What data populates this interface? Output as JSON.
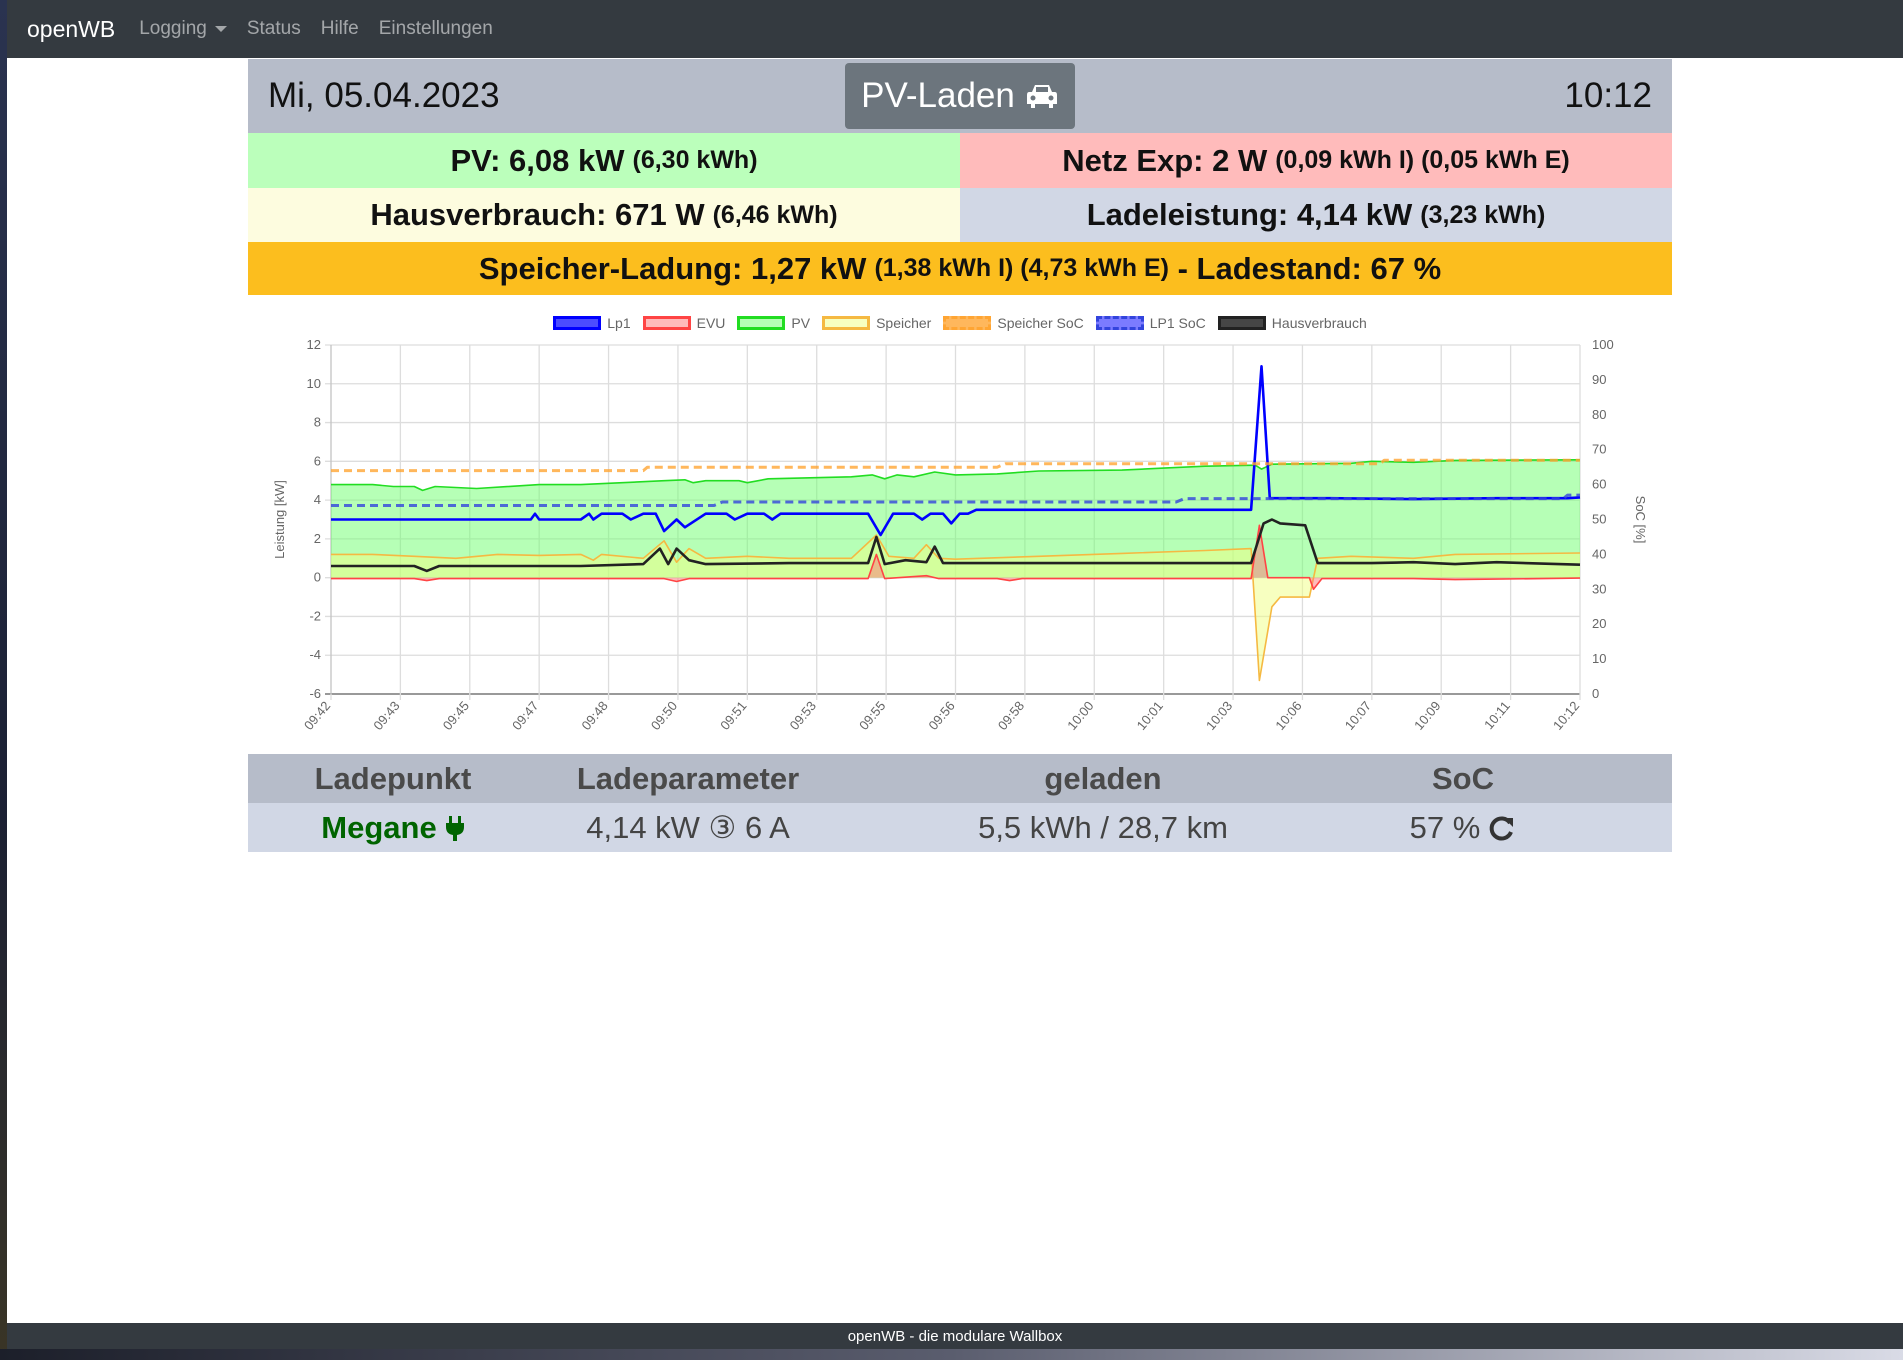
{
  "navbar": {
    "brand": "openWB",
    "items": [
      {
        "label": "Logging",
        "dropdown": true
      },
      {
        "label": "Status"
      },
      {
        "label": "Hilfe"
      },
      {
        "label": "Einstellungen"
      }
    ]
  },
  "header": {
    "date": "Mi, 05.04.2023",
    "mode": "PV-Laden",
    "mode_icon": "car-icon",
    "time": "10:12"
  },
  "summary": {
    "pv": {
      "label": "PV: 6,08 kW",
      "detail": "(6,30 kWh)",
      "color": "#bbffbb"
    },
    "netz": {
      "label": "Netz Exp: 2 W",
      "detail": "(0,09 kWh I) (0,05 kWh E)",
      "color": "#ffbbbb"
    },
    "haus": {
      "label": "Hausverbrauch: 671 W",
      "detail": "(6,46 kWh)",
      "color": "#fdfcdf"
    },
    "lade": {
      "label": "Ladeleistung: 4,14 kW",
      "detail": "(3,23 kWh)",
      "color": "#d1d7e5"
    },
    "speicher": {
      "label": "Speicher-Ladung: 1,27 kW",
      "detail": "(1,38 kWh I) (4,73 kWh E)",
      "sep": " - ",
      "ladestand": "Ladestand: 67 %",
      "color": "#fcbe1e"
    }
  },
  "chart_data": {
    "type": "line",
    "xlabel": "",
    "ylabel": "Leistung [kW]",
    "y2label": "SoC [%]",
    "ylim": [
      -6,
      12
    ],
    "y2lim": [
      0,
      100
    ],
    "xlim": [
      0,
      30
    ],
    "yticks": [
      "12",
      "10",
      "8",
      "6",
      "4",
      "2",
      "0",
      "-2",
      "-4",
      "-6"
    ],
    "y2ticks": [
      "100",
      "90",
      "80",
      "70",
      "60",
      "50",
      "40",
      "30",
      "20",
      "10",
      "0"
    ],
    "xticks": [
      "09:42",
      "09:43",
      "09:45",
      "09:47",
      "09:48",
      "09:50",
      "09:51",
      "09:53",
      "09:55",
      "09:56",
      "09:58",
      "10:00",
      "10:01",
      "10:03",
      "10:06",
      "10:07",
      "10:09",
      "10:11",
      "10:12"
    ],
    "x_unit": "minutes since 09:42",
    "legend": [
      {
        "name": "Lp1",
        "color": "#0000ff",
        "fill": "rgba(0,0,255,0.7)"
      },
      {
        "name": "EVU",
        "color": "#ff4444",
        "fill": "rgba(255,120,120,0.5)"
      },
      {
        "name": "PV",
        "color": "#22dd22",
        "fill": "rgba(110,255,110,0.5)"
      },
      {
        "name": "Speicher",
        "color": "#f5b942",
        "fill": "rgba(240,255,130,0.5)"
      },
      {
        "name": "Speicher SoC",
        "color": "#ffa533",
        "fill": "rgba(255,165,51,0.8)",
        "dashed": true
      },
      {
        "name": "LP1 SoC",
        "color": "#3344dd",
        "fill": "rgba(90,90,255,0.8)",
        "dashed": true
      },
      {
        "name": "Hausverbrauch",
        "color": "#222222",
        "fill": "rgba(50,50,50,0.9)"
      }
    ],
    "series": [
      {
        "name": "PV",
        "axis": "y",
        "fill": true,
        "points": [
          [
            0,
            4.8
          ],
          [
            1,
            4.8
          ],
          [
            1.5,
            4.7
          ],
          [
            2,
            4.7
          ],
          [
            2.2,
            4.5
          ],
          [
            2.5,
            4.7
          ],
          [
            3.5,
            4.6
          ],
          [
            5,
            4.8
          ],
          [
            6,
            4.8
          ],
          [
            8,
            5.0
          ],
          [
            8.5,
            5.05
          ],
          [
            8.7,
            4.9
          ],
          [
            9,
            5.0
          ],
          [
            9.8,
            5.0
          ],
          [
            10,
            4.9
          ],
          [
            10.5,
            5.1
          ],
          [
            12.5,
            5.2
          ],
          [
            13,
            5.3
          ],
          [
            13.3,
            5.1
          ],
          [
            13.6,
            5.3
          ],
          [
            14,
            5.2
          ],
          [
            14.5,
            5.45
          ],
          [
            15,
            5.3
          ],
          [
            16,
            5.35
          ],
          [
            17,
            5.5
          ],
          [
            19,
            5.55
          ],
          [
            20,
            5.65
          ],
          [
            21,
            5.75
          ],
          [
            22.2,
            5.8
          ],
          [
            22.35,
            5.6
          ],
          [
            22.6,
            5.85
          ],
          [
            24.5,
            5.9
          ],
          [
            25,
            6.0
          ],
          [
            26,
            5.95
          ],
          [
            27,
            6.05
          ],
          [
            30,
            6.08
          ]
        ]
      },
      {
        "name": "Speicher",
        "axis": "y",
        "fill": true,
        "points": [
          [
            0,
            1.2
          ],
          [
            1,
            1.2
          ],
          [
            2,
            1.1
          ],
          [
            3,
            1.0
          ],
          [
            4,
            1.2
          ],
          [
            5,
            1.15
          ],
          [
            6,
            1.2
          ],
          [
            6.3,
            0.9
          ],
          [
            6.5,
            1.2
          ],
          [
            7.5,
            1.0
          ],
          [
            8,
            1.9
          ],
          [
            8.3,
            0.8
          ],
          [
            8.6,
            1.5
          ],
          [
            9,
            1.0
          ],
          [
            10,
            1.1
          ],
          [
            11,
            1.0
          ],
          [
            12.5,
            1.0
          ],
          [
            13.1,
            2.2
          ],
          [
            13.4,
            1.1
          ],
          [
            14,
            1.0
          ],
          [
            14.3,
            1.7
          ],
          [
            14.6,
            1.0
          ],
          [
            15,
            0.95
          ],
          [
            17,
            1.1
          ],
          [
            19,
            1.25
          ],
          [
            21,
            1.4
          ],
          [
            22.1,
            1.5
          ],
          [
            22.3,
            -5.3
          ],
          [
            22.6,
            -1.5
          ],
          [
            22.8,
            -1.0
          ],
          [
            23.5,
            -1.0
          ],
          [
            23.7,
            1.0
          ],
          [
            24.5,
            1.1
          ],
          [
            26,
            1.0
          ],
          [
            27,
            1.2
          ],
          [
            30,
            1.27
          ]
        ]
      },
      {
        "name": "EVU",
        "axis": "y",
        "fill": true,
        "points": [
          [
            0,
            -0.05
          ],
          [
            2,
            -0.05
          ],
          [
            2.3,
            -0.15
          ],
          [
            2.6,
            -0.05
          ],
          [
            8,
            -0.05
          ],
          [
            8.3,
            -0.2
          ],
          [
            8.6,
            -0.05
          ],
          [
            12.9,
            -0.05
          ],
          [
            13.1,
            1.2
          ],
          [
            13.3,
            -0.05
          ],
          [
            14.3,
            0.1
          ],
          [
            14.6,
            -0.05
          ],
          [
            16,
            -0.05
          ],
          [
            16.3,
            -0.15
          ],
          [
            16.6,
            -0.05
          ],
          [
            22.1,
            -0.05
          ],
          [
            22.3,
            2.7
          ],
          [
            22.5,
            0.0
          ],
          [
            23.5,
            0.0
          ],
          [
            23.6,
            -0.6
          ],
          [
            23.8,
            -0.05
          ],
          [
            26,
            -0.05
          ],
          [
            27,
            -0.1
          ],
          [
            30,
            -0.02
          ]
        ]
      },
      {
        "name": "Lp1",
        "axis": "y",
        "fill": false,
        "points": [
          [
            0,
            3.0
          ],
          [
            4.8,
            3.0
          ],
          [
            4.9,
            3.3
          ],
          [
            5.0,
            3.0
          ],
          [
            6,
            3.0
          ],
          [
            6.2,
            3.3
          ],
          [
            6.3,
            3.0
          ],
          [
            6.5,
            3.3
          ],
          [
            7,
            3.3
          ],
          [
            7.2,
            3.0
          ],
          [
            7.5,
            3.3
          ],
          [
            7.8,
            3.3
          ],
          [
            8,
            2.4
          ],
          [
            8.3,
            3.0
          ],
          [
            8.5,
            2.6
          ],
          [
            9,
            3.3
          ],
          [
            9.5,
            3.3
          ],
          [
            9.7,
            3.0
          ],
          [
            10,
            3.3
          ],
          [
            10.4,
            3.3
          ],
          [
            10.6,
            3.0
          ],
          [
            10.8,
            3.3
          ],
          [
            12.9,
            3.3
          ],
          [
            13.2,
            2.2
          ],
          [
            13.5,
            3.3
          ],
          [
            14,
            3.3
          ],
          [
            14.2,
            3.0
          ],
          [
            14.4,
            3.3
          ],
          [
            14.7,
            3.3
          ],
          [
            14.9,
            2.8
          ],
          [
            15.1,
            3.3
          ],
          [
            15.3,
            3.3
          ],
          [
            15.5,
            3.5
          ],
          [
            22.1,
            3.5
          ],
          [
            22.35,
            10.9
          ],
          [
            22.55,
            4.1
          ],
          [
            24,
            4.1
          ],
          [
            26,
            4.05
          ],
          [
            28,
            4.1
          ],
          [
            29.7,
            4.1
          ],
          [
            30,
            4.14
          ]
        ]
      },
      {
        "name": "Hausverbrauch",
        "axis": "y",
        "fill": false,
        "points": [
          [
            0,
            0.6
          ],
          [
            2,
            0.6
          ],
          [
            2.3,
            0.35
          ],
          [
            2.6,
            0.6
          ],
          [
            6,
            0.6
          ],
          [
            7.5,
            0.7
          ],
          [
            7.9,
            1.5
          ],
          [
            8.1,
            0.7
          ],
          [
            8.3,
            1.5
          ],
          [
            8.6,
            0.9
          ],
          [
            9,
            0.7
          ],
          [
            11,
            0.75
          ],
          [
            12.9,
            0.75
          ],
          [
            13.1,
            2.1
          ],
          [
            13.3,
            0.7
          ],
          [
            13.8,
            0.9
          ],
          [
            14.3,
            0.8
          ],
          [
            14.5,
            1.6
          ],
          [
            14.7,
            0.75
          ],
          [
            17,
            0.75
          ],
          [
            20,
            0.75
          ],
          [
            22.1,
            0.75
          ],
          [
            22.4,
            2.8
          ],
          [
            22.6,
            3.0
          ],
          [
            22.8,
            2.8
          ],
          [
            23.4,
            2.7
          ],
          [
            23.7,
            0.75
          ],
          [
            25,
            0.75
          ],
          [
            26,
            0.8
          ],
          [
            27,
            0.7
          ],
          [
            28,
            0.8
          ],
          [
            30,
            0.67
          ]
        ]
      },
      {
        "name": "Speicher SoC",
        "axis": "y2",
        "dashed": true,
        "points": [
          [
            0,
            64
          ],
          [
            7.5,
            64
          ],
          [
            7.6,
            65
          ],
          [
            16,
            65
          ],
          [
            16.2,
            66
          ],
          [
            25.2,
            66
          ],
          [
            25.3,
            67
          ],
          [
            30,
            67
          ]
        ]
      },
      {
        "name": "LP1 SoC",
        "axis": "y2",
        "dashed": true,
        "points": [
          [
            0,
            54
          ],
          [
            9.2,
            54
          ],
          [
            9.4,
            55
          ],
          [
            20.3,
            55
          ],
          [
            20.5,
            56
          ],
          [
            29.6,
            56
          ],
          [
            29.7,
            57
          ],
          [
            30,
            57
          ]
        ]
      }
    ]
  },
  "table": {
    "headers": [
      "Ladepunkt",
      "Ladeparameter",
      "geladen",
      "SoC"
    ],
    "rows": [
      {
        "name": "Megane",
        "name_color": "#006400",
        "plug_icon": "plug-icon",
        "param": "4,14 kW ③ 6 A",
        "charged": "5,5 kWh / 28,7 km",
        "soc": "57 %",
        "refresh_icon": "refresh-icon"
      }
    ]
  },
  "footer": {
    "text": "openWB - die modulare Wallbox"
  }
}
